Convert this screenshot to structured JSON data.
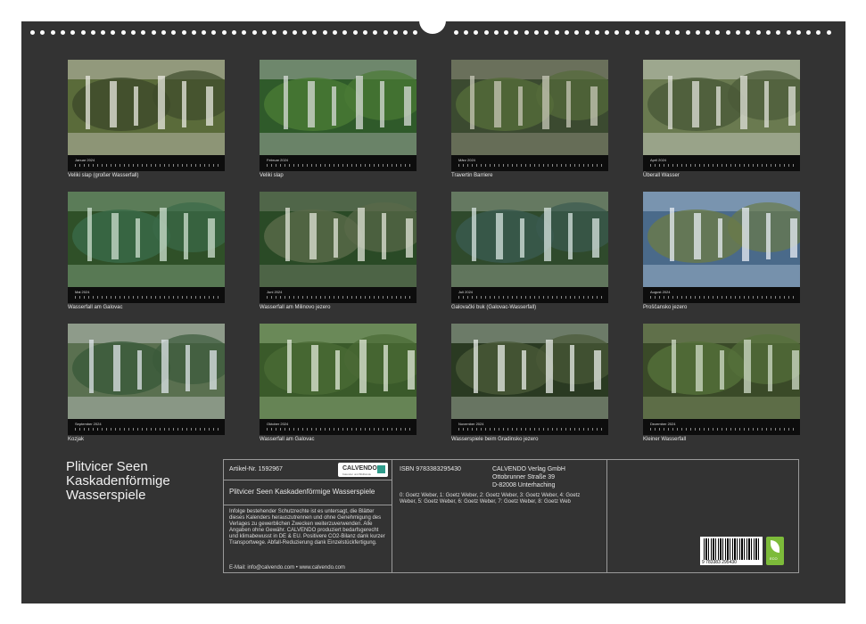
{
  "months": [
    {
      "month": "Januar 2024",
      "caption": "Veliki slap (großer Wasserfall)"
    },
    {
      "month": "Februar 2024",
      "caption": "Veliki slap"
    },
    {
      "month": "März 2024",
      "caption": "Travertin Barriere"
    },
    {
      "month": "April 2024",
      "caption": "Überall Wasser"
    },
    {
      "month": "Mai 2024",
      "caption": "Wasserfall am Galovac"
    },
    {
      "month": "Juni 2024",
      "caption": "Wasserfall am Milinovo jezero"
    },
    {
      "month": "Juli 2024",
      "caption": "Galovački buk (Galovac-Wasserfall)"
    },
    {
      "month": "August 2024",
      "caption": "Proščansko jezero"
    },
    {
      "month": "September 2024",
      "caption": "Kozjak"
    },
    {
      "month": "Oktober 2024",
      "caption": "Wasserfall am Galovac"
    },
    {
      "month": "November 2024",
      "caption": "Wasserspiele beim Gradinsko jezero"
    },
    {
      "month": "Dezember 2024",
      "caption": "Kleiner Wasserfall"
    }
  ],
  "title": {
    "line1": "Plitvicer Seen",
    "line2": "Kaskadenförmige",
    "line3": "Wasserspiele"
  },
  "info": {
    "article": "Artikel-Nr. 1592967",
    "logo": "CALVENDO",
    "logo_sub": "Kalender und Bildbände",
    "product_title": "Plitvicer Seen Kaskadenförmige Wasserspiele",
    "legal": "Infolge bestehender Schutzrechte ist es untersagt, die Blätter dieses Kalenders herauszutrennen und ohne Genehmigung des Verlages zu gewerblichen Zwecken weiterzuverwenden. Alle Angaben ohne Gewähr. CALVENDO produziert bedarfsgerecht und klimabewusst in DE & EU. Positivere CO2-Bilanz dank kurzer Transportwege. Abfall-Reduzierung dank Einzelstückfertigung.",
    "email": "E-Mail: info@calvendo.com • www.calvendo.com",
    "isbn": "ISBN 9783383295430",
    "publisher": "CALVENDO Verlag GmbH",
    "street": "Ottobrunner Straße 39",
    "city": "D-82008 Unterhaching",
    "credits": "0: Goetz Weber, 1: Goetz Weber, 2: Goetz Weber, 3: Goetz Weber, 4: Goetz Weber, 5: Goetz Weber, 6: Goetz Weber, 7: Goetz Weber, 8: Goetz Web",
    "barcode_number": "9 783383 295430",
    "eco_label": "ECO"
  }
}
